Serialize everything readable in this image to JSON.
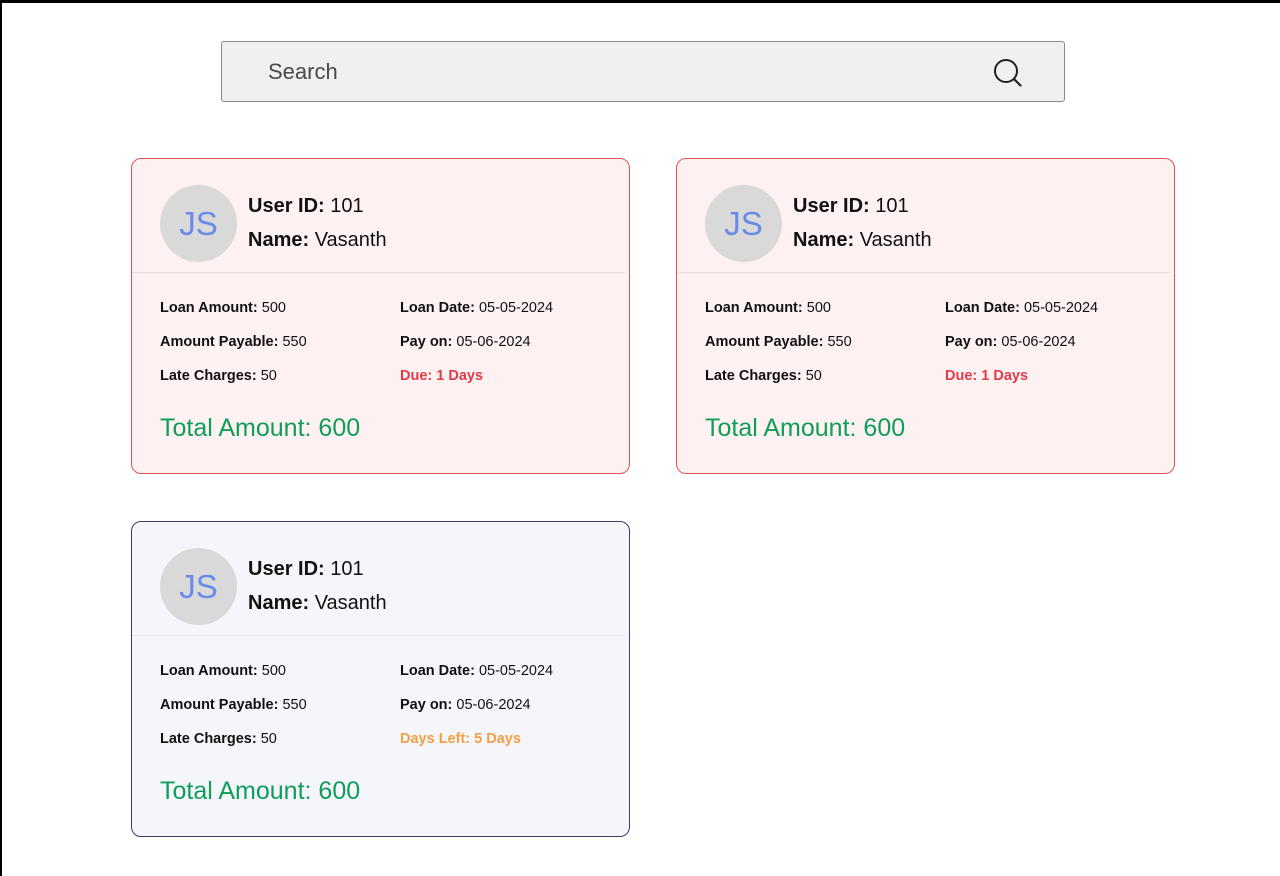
{
  "search": {
    "placeholder": "Search"
  },
  "colors": {
    "overdue_border": "#e0525b",
    "overdue_background": "#fdf1f2",
    "upcoming_border": "#3f3a68",
    "upcoming_background": "#f5f6fb",
    "total_text": "#0f9d58",
    "due_text": "#e23b4a",
    "days_left_text": "#f3a043",
    "avatar_initials": "#6b8bea",
    "avatar_background": "#d9d9d9"
  },
  "cards": [
    {
      "avatar_initials": "JS",
      "user_id_label": "User ID:",
      "user_id": "101",
      "name_label": "Name:",
      "name": "Vasanth",
      "loan_amount_label": "Loan Amount:",
      "loan_amount": "500",
      "amount_payable_label": "Amount Payable:",
      "amount_payable": "550",
      "late_charges_label": "Late Charges:",
      "late_charges": "50",
      "loan_date_label": "Loan Date:",
      "loan_date": "05-05-2024",
      "pay_on_label": "Pay on:",
      "pay_on": "05-06-2024",
      "status": "Due: 1 Days",
      "total": "Total Amount: 600"
    },
    {
      "avatar_initials": "JS",
      "user_id_label": "User ID:",
      "user_id": "101",
      "name_label": "Name:",
      "name": "Vasanth",
      "loan_amount_label": "Loan Amount:",
      "loan_amount": "500",
      "amount_payable_label": "Amount Payable:",
      "amount_payable": "550",
      "late_charges_label": "Late Charges:",
      "late_charges": "50",
      "loan_date_label": "Loan Date:",
      "loan_date": "05-05-2024",
      "pay_on_label": "Pay on:",
      "pay_on": "05-06-2024",
      "status": "Due: 1 Days",
      "total": "Total Amount: 600"
    },
    {
      "avatar_initials": "JS",
      "user_id_label": "User ID:",
      "user_id": "101",
      "name_label": "Name:",
      "name": "Vasanth",
      "loan_amount_label": "Loan Amount:",
      "loan_amount": "500",
      "amount_payable_label": "Amount Payable:",
      "amount_payable": "550",
      "late_charges_label": "Late Charges:",
      "late_charges": "50",
      "loan_date_label": "Loan Date:",
      "loan_date": "05-05-2024",
      "pay_on_label": "Pay on:",
      "pay_on": "05-06-2024",
      "status": "Days Left: 5 Days",
      "total": "Total Amount: 600"
    }
  ]
}
